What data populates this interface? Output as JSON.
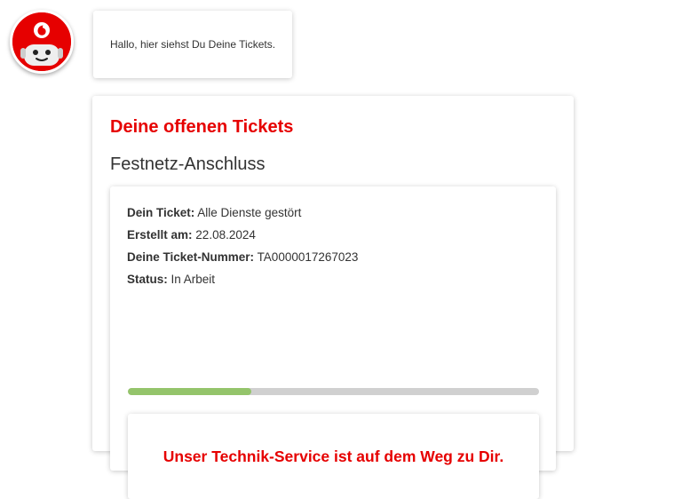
{
  "avatar": {
    "icon": "vodafone-robot-avatar",
    "brand_color": "#e60000"
  },
  "greeting": {
    "text": "Hallo, hier siehst Du Deine Tickets."
  },
  "tickets_card": {
    "title": "Deine offenen Tickets",
    "category": "Festnetz-Anschluss",
    "ticket": {
      "ticket_label": "Dein Ticket:",
      "ticket_value": "Alle Dienste gestört",
      "created_label": "Erstellt am:",
      "created_value": "22.08.2024",
      "number_label": "Deine Ticket-Nummer:",
      "number_value": "TA0000017267023",
      "status_label": "Status:",
      "status_value": "In Arbeit",
      "progress_percent": 30,
      "progress_color": "#94c46b",
      "notice": "Unser Technik-Service ist auf dem Weg zu Dir."
    }
  }
}
